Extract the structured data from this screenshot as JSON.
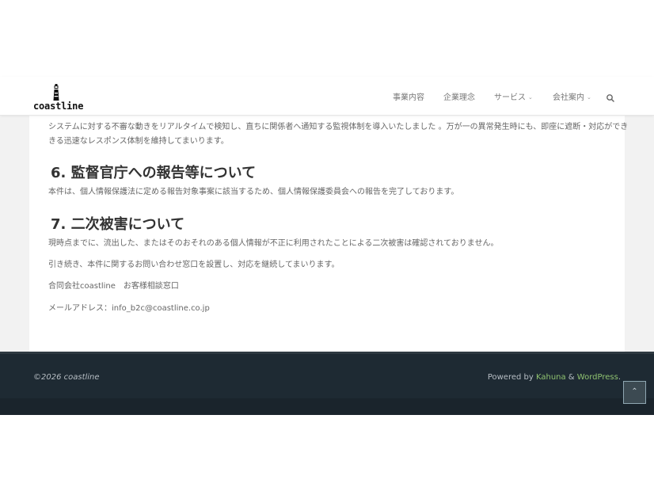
{
  "site": {
    "logo_text": "coastline",
    "logo_icon": "lighthouse-icon"
  },
  "nav": {
    "items": [
      {
        "label": "事業内容",
        "has_dropdown": false
      },
      {
        "label": "企業理念",
        "has_dropdown": false
      },
      {
        "label": "サービス",
        "has_dropdown": true
      },
      {
        "label": "会社案内",
        "has_dropdown": true
      }
    ],
    "chevron": "⌄",
    "search_icon": "search-icon"
  },
  "article": {
    "intro_line1": "システムに対する不審な動きをリアルタイムで検知し、直ちに関係者へ通知する監視体制を導入いたしました 。万が一の異常発生時にも、即座に遮断・対応ができ",
    "intro_line2": "きる迅速なレスポンス体制を維持してまいります。",
    "section6_heading": "6. 監督官庁への報告等について",
    "section6_text": "本件は、個人情報保護法に定める報告対象事案に該当するため、個人情報保護委員会への報告を完了しております。",
    "section7_heading": "7. 二次被害について",
    "section7_text1": "現時点までに、流出した、またはそのおそれのある個人情報が不正に利用されたことによる二次被害は確認されておりません。",
    "section7_text2": "引き続き、本件に関するお問い合わせ窓口を設置し、対応を継続してまいります。",
    "contact_name": "合同会社coastline　お客様相談窓口",
    "contact_email": "メールアドレス：info_b2c@coastline.co.jp"
  },
  "footer": {
    "copyright": "©2026 coastline",
    "powered_prefix": "Powered by ",
    "theme_link": "Kahuna",
    "amp": " & ",
    "wp_link": "WordPress",
    "suffix": ".",
    "to_top_icon": "chevron-up-icon",
    "to_top_glyph": "⌃"
  },
  "colors": {
    "link_green": "#8fc270",
    "footer_bg": "#1e2a33",
    "content_bg": "#f2f2f2"
  }
}
